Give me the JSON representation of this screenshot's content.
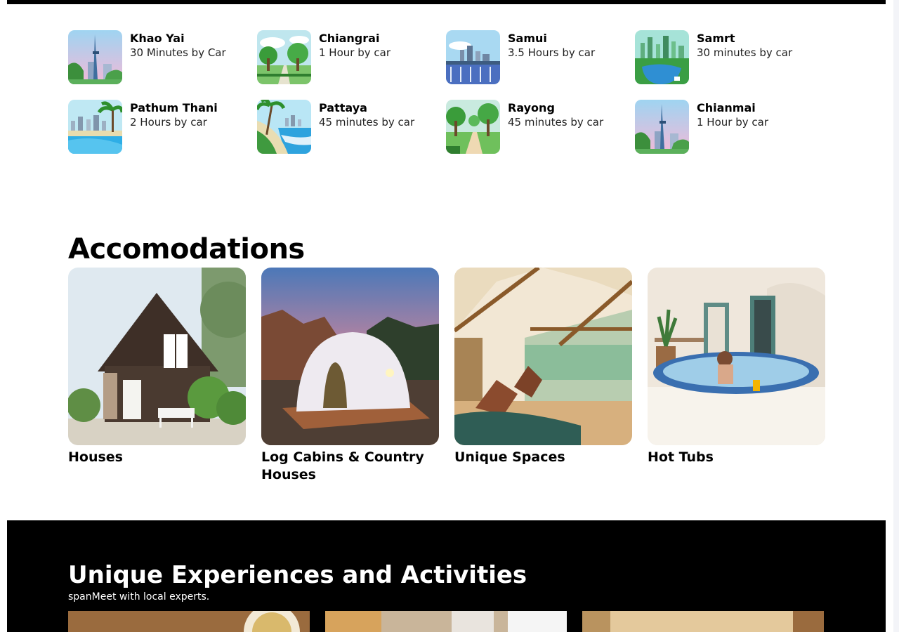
{
  "nearby": {
    "items": [
      {
        "name": "Khao Yai",
        "distance": "30 Minutes by Car",
        "icon": "tower-city-icon"
      },
      {
        "name": "Chiangrai",
        "distance": "1 Hour by car",
        "icon": "park-icon"
      },
      {
        "name": "Samui",
        "distance": "3.5 Hours by car",
        "icon": "bridge-city-icon"
      },
      {
        "name": "Samrt",
        "distance": "30 minutes by car",
        "icon": "skyline-lake-icon"
      },
      {
        "name": "Pathum Thani",
        "distance": "2 Hours by car",
        "icon": "beach-city-icon"
      },
      {
        "name": "Pattaya",
        "distance": "45 minutes by car",
        "icon": "palm-beach-icon"
      },
      {
        "name": "Rayong",
        "distance": "45 minutes by car",
        "icon": "park-path-icon"
      },
      {
        "name": "Chianmai",
        "distance": "1 Hour by car",
        "icon": "tower-city-icon"
      }
    ]
  },
  "accommodations": {
    "title": "Accomodations",
    "cards": [
      {
        "label": "Houses"
      },
      {
        "label": "Log Cabins & Country Houses"
      },
      {
        "label": "Unique Spaces"
      },
      {
        "label": "Hot Tubs"
      }
    ]
  },
  "experiences": {
    "title": "Unique Experiences and Activities",
    "subtitle": "spanMeet with local experts."
  },
  "colors": {
    "background": "#ffffff",
    "dark_section": "#000000",
    "text": "#000000"
  }
}
